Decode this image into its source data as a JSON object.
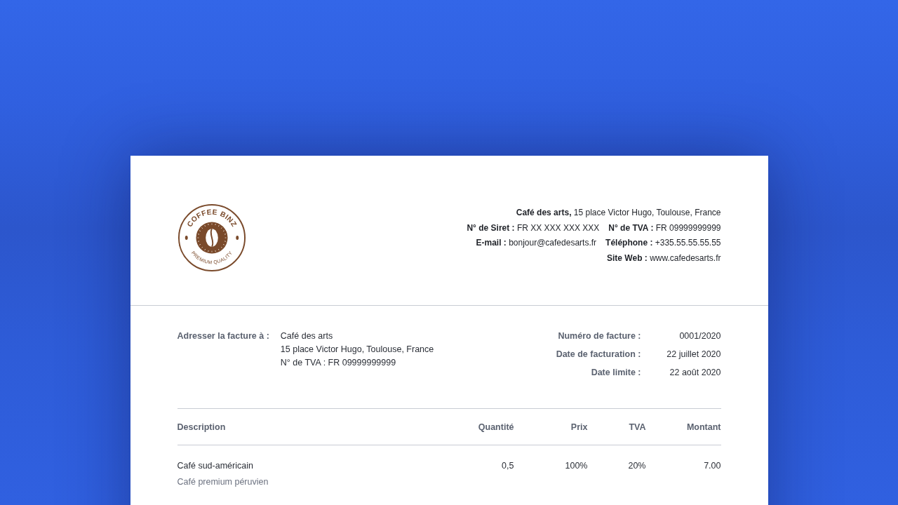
{
  "logo": {
    "top_text": "COFFEE BINZ",
    "bottom_text": "PREMIUM QUALITY"
  },
  "company": {
    "lines": [
      [
        {
          "label": "Café des arts,",
          "value": "15 place Victor Hugo, Toulouse, France"
        }
      ],
      [
        {
          "label": "N° de Siret :",
          "value": "FR XX XXX XXX XXX"
        },
        {
          "label": "N° de TVA :",
          "value": "FR 09999999999"
        }
      ],
      [
        {
          "label": "E-mail :",
          "value": "bonjour@cafedesarts.fr"
        },
        {
          "label": "Téléphone :",
          "value": "+335.55.55.55.55"
        }
      ],
      [
        {
          "label": "Site Web :",
          "value": "www.cafedesarts.fr"
        }
      ]
    ]
  },
  "bill_to": {
    "label": "Adresser la facture à :",
    "lines": [
      "Café des arts",
      " 15 place Victor Hugo, Toulouse, France",
      "N° de TVA : FR 09999999999"
    ]
  },
  "invoice_meta": [
    {
      "label": "Numéro de facture :",
      "value": "0001/2020"
    },
    {
      "label": "Date de facturation :",
      "value": "22 juillet 2020"
    },
    {
      "label": "Date limite :",
      "value": "22 août 2020"
    }
  ],
  "table": {
    "columns": [
      "Description",
      "Quantité",
      "Prix",
      "TVA",
      "Montant"
    ],
    "rows": [
      {
        "description": "Café sud-américain",
        "detail": "Café premium péruvien",
        "quantity": "0,5",
        "price": "100%",
        "tva": "20%",
        "amount": "7.00"
      }
    ]
  }
}
